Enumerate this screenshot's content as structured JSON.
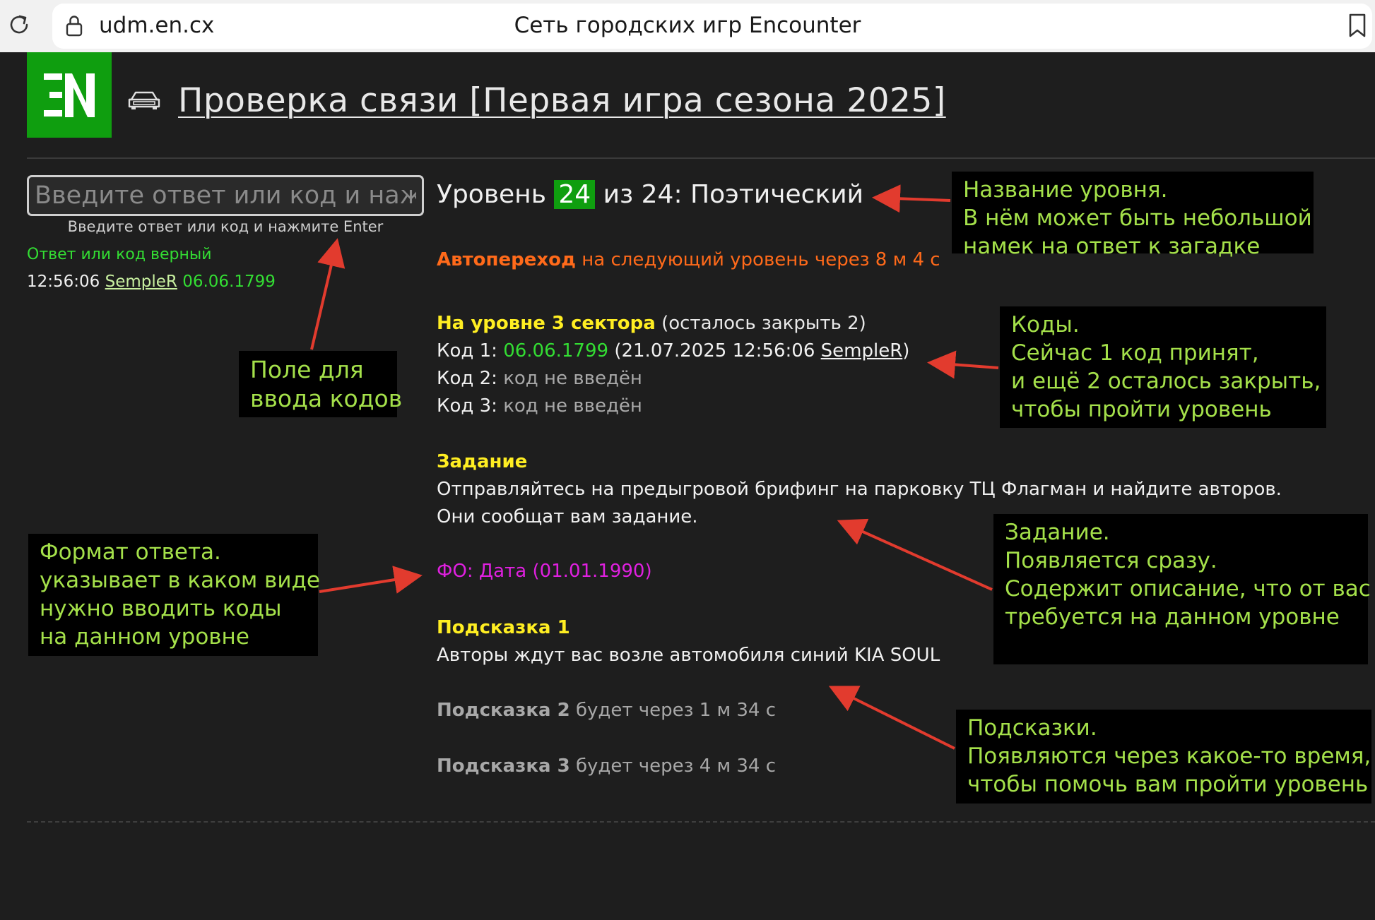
{
  "browser": {
    "url": "udm.en.cx",
    "title": "Сеть городских игр Encounter"
  },
  "header": {
    "game_title": "Проверка связи [Первая игра сезона 2025]"
  },
  "answer_panel": {
    "placeholder": "Введите ответ или код и нажмите Enter",
    "hint": "Введите ответ или код и нажмите Enter",
    "status": "Ответ или код верный",
    "last_time": "12:56:06",
    "last_user": "SempleR",
    "last_code": "06.06.1799"
  },
  "level": {
    "prefix": "Уровень",
    "number": "24",
    "suffix": "из 24: Поэтический"
  },
  "autotransition": {
    "label": "Автопереход",
    "text": "на следующий уровень через 8 м 4 с"
  },
  "sectors": {
    "head": "На уровне 3 сектора",
    "remaining": "(осталось закрыть 2)",
    "codes": [
      {
        "label": "Код 1:",
        "value": "06.06.1799",
        "meta_open": "(21.07.2025 12:56:06 ",
        "user": "SempleR",
        "meta_close": ")"
      },
      {
        "label": "Код 2:",
        "value": "код не введён"
      },
      {
        "label": "Код 3:",
        "value": "код не введён"
      }
    ]
  },
  "task": {
    "head": "Задание",
    "line1": "Отправляйтесь на предыгровой брифинг на парковку ТЦ Флагман и найдите авторов.",
    "line2": "Они сообщат вам задание."
  },
  "format": {
    "text": "ФО: Дата (01.01.1990)"
  },
  "hints": [
    {
      "head": "Подсказка 1",
      "text": "Авторы ждут вас возле автомобиля синий KIA SOUL"
    },
    {
      "head": "Подсказка 2",
      "text": "будет через 1 м 34 с"
    },
    {
      "head": "Подсказка 3",
      "text": "будет через 4 м 34 с"
    }
  ],
  "callouts": {
    "level_name": "Название уровня.\nВ нём может быть небольшой\nнамек на ответ к загадке",
    "input_field": "Поле для\nввода кодов",
    "codes": "Коды.\nСейчас 1 код принят,\nи ещё 2 осталось закрыть,\nчтобы пройти уровень",
    "task": "Задание.\nПоявляется сразу.\nСодержит описание, что от вас\nтребуется на данном уровне",
    "format": "Формат ответа.\nуказывает в каком виде\nнужно вводить коды\nна данном уровне",
    "hints": "Подсказки.\nПоявляются через какое-то время,\nчтобы помочь вам пройти уровень"
  },
  "colors": {
    "brand_green": "#0f9e0f",
    "accent_orange": "#ff6a1a",
    "accent_yellow": "#ffee22",
    "accent_magenta": "#e020e0",
    "ok_green": "#33dd33",
    "callout_text": "#a4e04a",
    "arrow_red": "#e23b2e"
  },
  "icons": [
    "reload-icon",
    "lock-icon",
    "bookmark-icon",
    "logo-icon",
    "car-icon"
  ]
}
